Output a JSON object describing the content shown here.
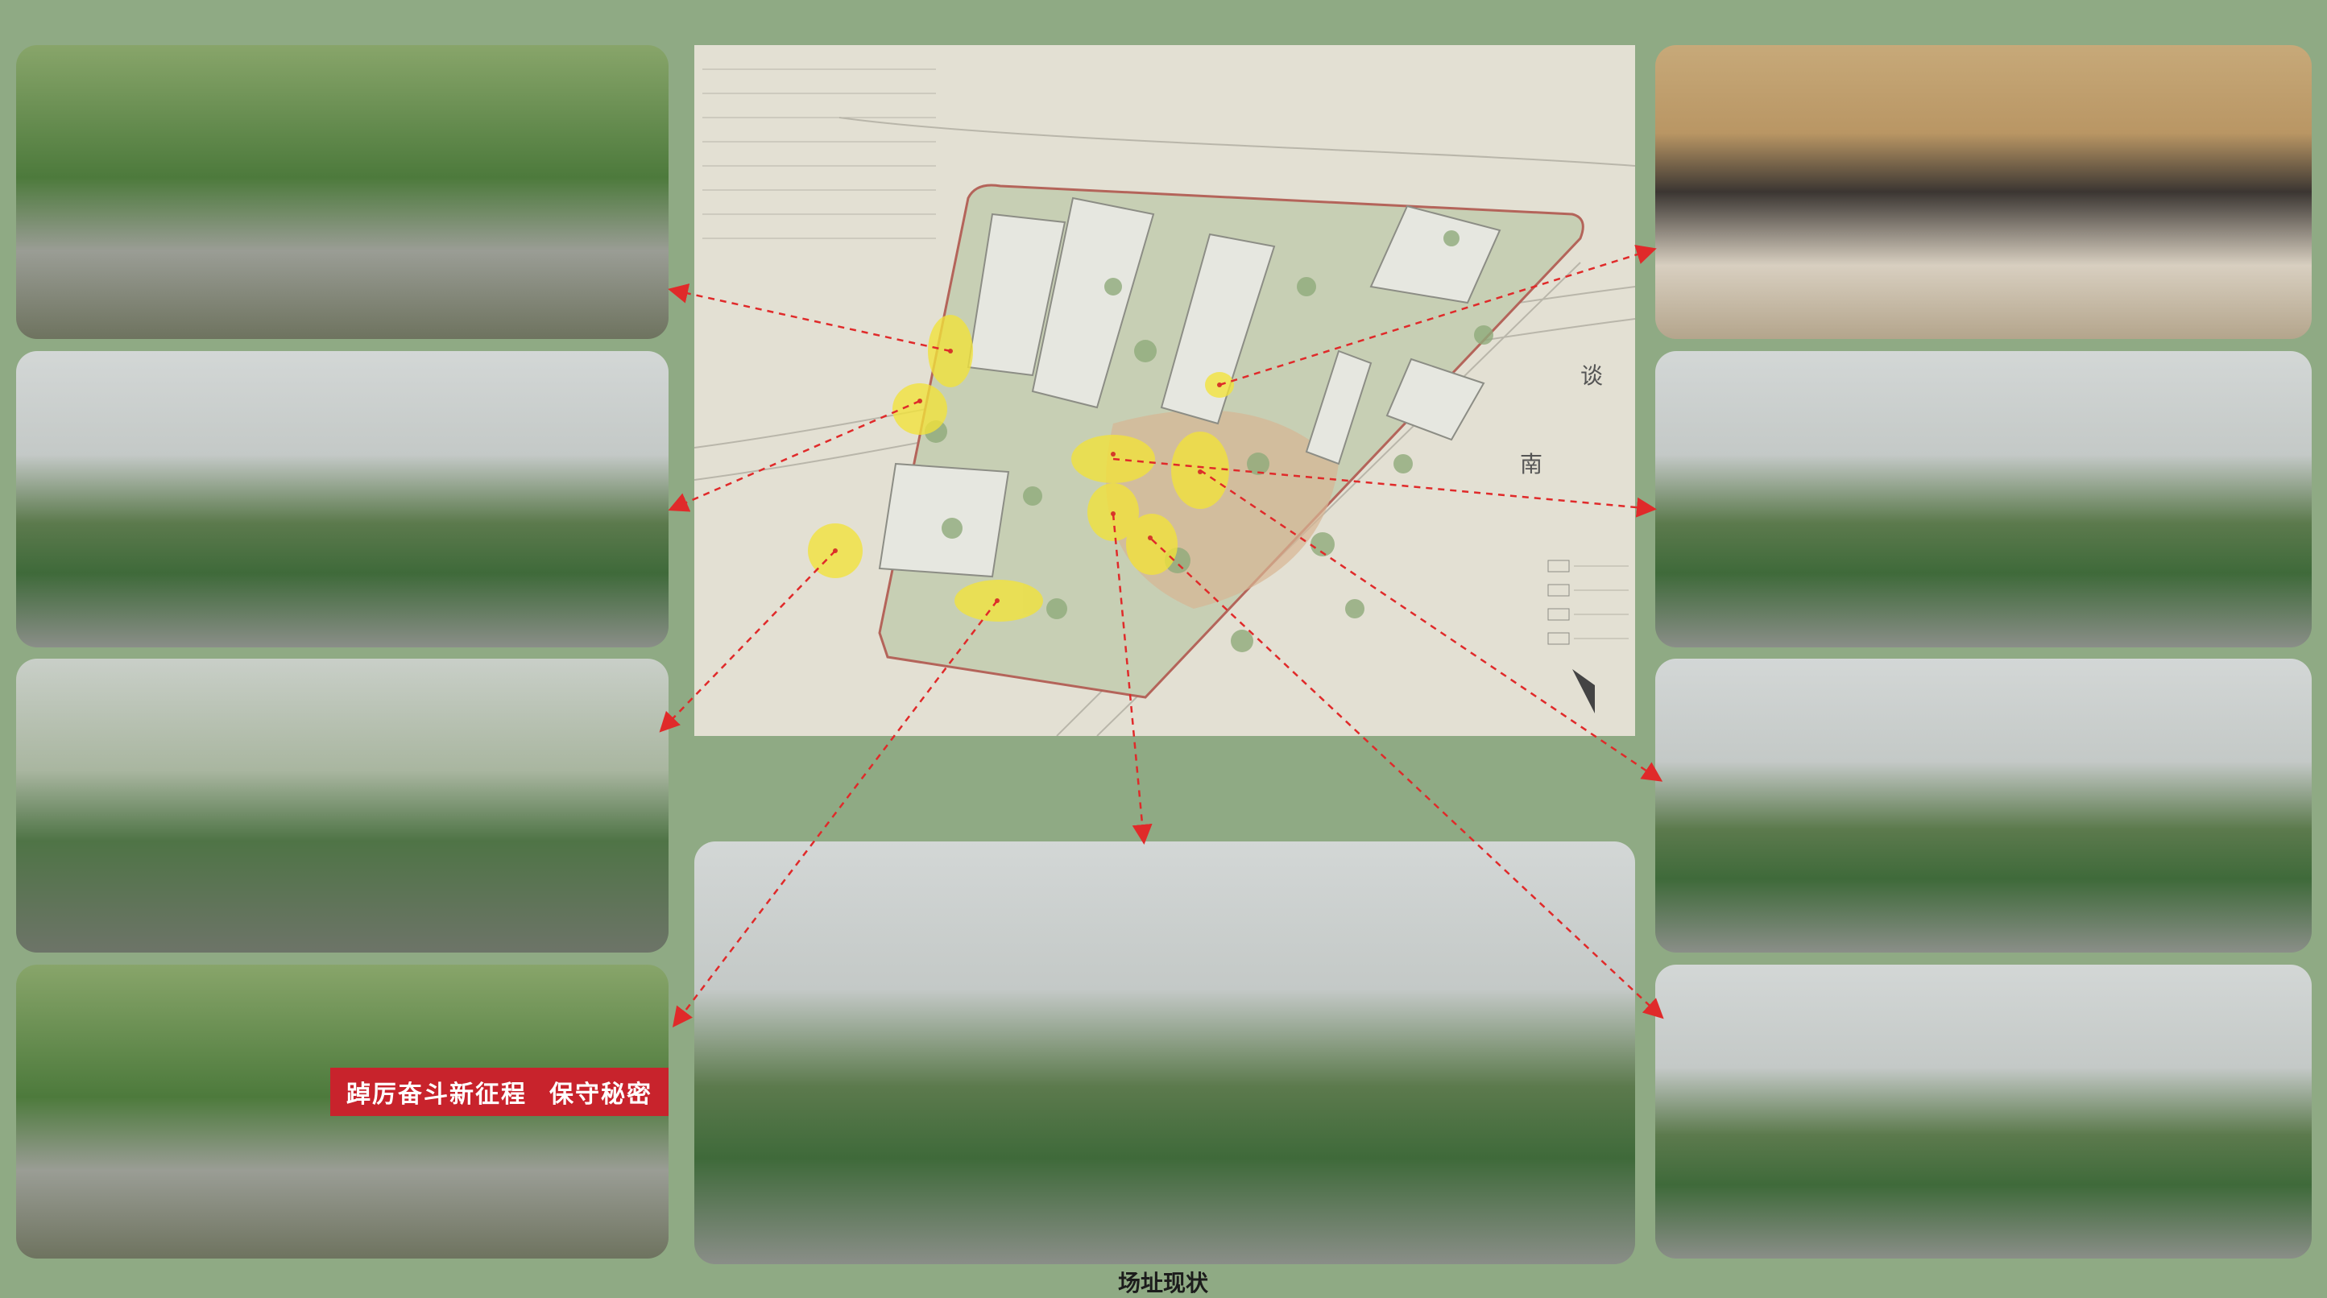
{
  "caption": "场址现状",
  "site_plan": {
    "label_a": "南",
    "label_b": "谈"
  },
  "photos": {
    "left_4_banner": {
      "text1": "踔厉奋斗新征程",
      "text2": "保守秘密"
    }
  },
  "colors": {
    "background": "#8faa84",
    "highlight": "#f2e33a",
    "arrow": "#e02a2a"
  }
}
